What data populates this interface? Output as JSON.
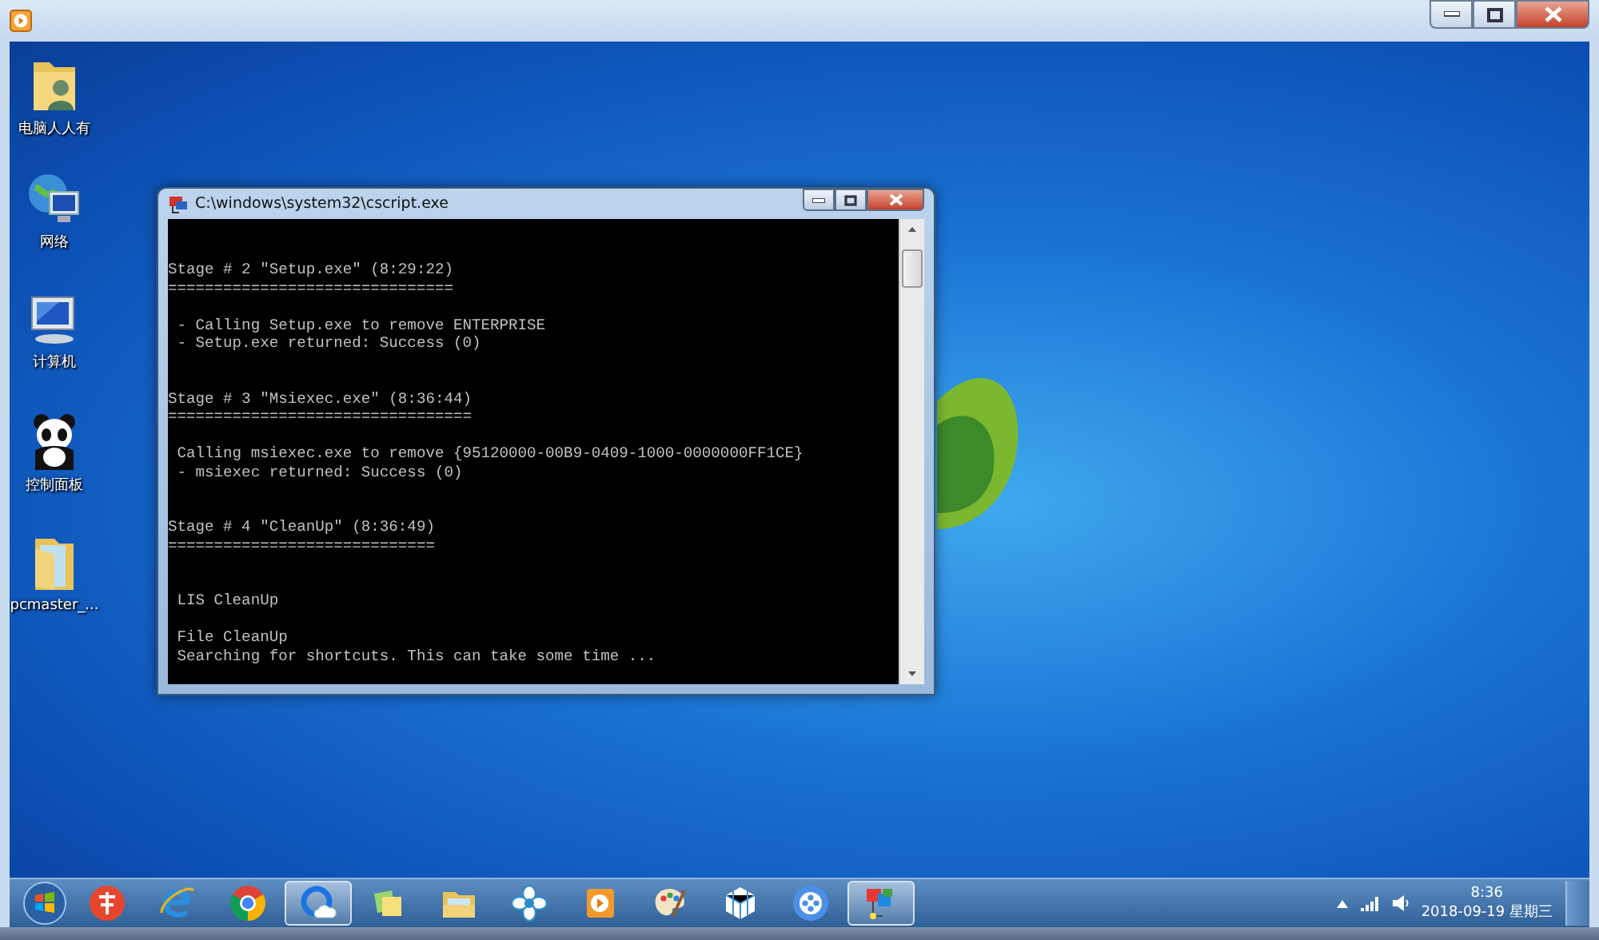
{
  "desktop_icons": [
    {
      "label": "电脑人人有"
    },
    {
      "label": "网络"
    },
    {
      "label": "计算机"
    },
    {
      "label": "控制面板"
    },
    {
      "label": "pcmaster_..."
    }
  ],
  "console": {
    "title": "C:\\windows\\system32\\cscript.exe",
    "blocks": [
      {
        "kind": "stage",
        "lines": [
          "Stage # 2 \"Setup.exe\" (8:29:22)",
          "==============================="
        ]
      },
      {
        "kind": "result",
        "lines": [
          " - Calling Setup.exe to remove ENTERPRISE",
          " - Setup.exe returned: Success (0)"
        ]
      },
      {
        "kind": "stage",
        "lines": [
          "Stage # 3 \"Msiexec.exe\" (8:36:44)",
          "================================="
        ]
      },
      {
        "kind": "result",
        "lines": [
          " Calling msiexec.exe to remove {95120000-00B9-0409-1000-0000000FF1CE}",
          " - msiexec returned: Success (0)"
        ]
      },
      {
        "kind": "stage",
        "lines": [
          "Stage # 4 \"CleanUp\" (8:36:49)",
          "============================="
        ]
      },
      {
        "kind": "stage",
        "lines": [
          " LIS CleanUp"
        ]
      },
      {
        "kind": "result",
        "lines": [
          " File CleanUp",
          " Searching for shortcuts. This can take some time ..."
        ]
      }
    ]
  },
  "taskbar": {
    "apps": [
      {
        "selected": false
      },
      {
        "selected": false
      },
      {
        "selected": false
      },
      {
        "selected": true
      },
      {
        "selected": false
      },
      {
        "selected": false
      },
      {
        "selected": false
      },
      {
        "selected": false
      },
      {
        "selected": false
      },
      {
        "selected": false
      },
      {
        "selected": false
      },
      {
        "selected": true
      }
    ],
    "clock": {
      "time": "8:36",
      "date": "2018-09-19 星期三"
    }
  }
}
